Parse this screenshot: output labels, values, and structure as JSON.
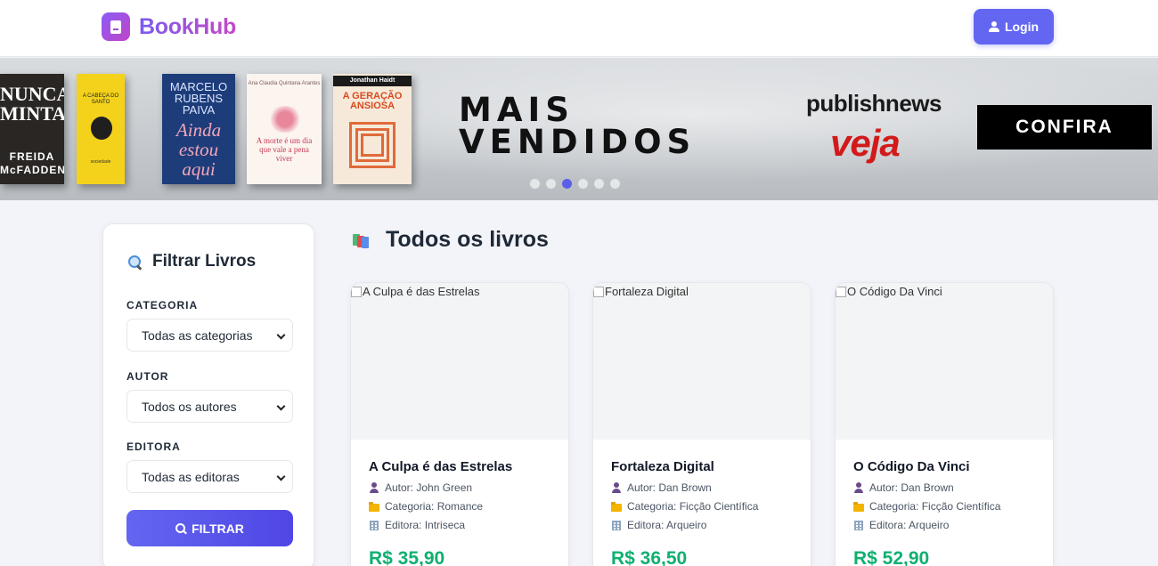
{
  "header": {
    "brand": "BookHub",
    "login_label": "Login"
  },
  "banner": {
    "books": [
      {
        "title": "NUNCA MINTA",
        "author": "FREIDA McFADDEN"
      },
      {
        "title": "A CABEÇA DO SANTO",
        "author": "sociedade"
      },
      {
        "title": "Ainda estou aqui",
        "author": "MARCELO RUBENS PAIVA"
      },
      {
        "title": "A morte é um dia que vale a pena viver",
        "author": "Ana Claudia Quintana Arantes"
      },
      {
        "title": "A GERAÇÃO ANSIOSA",
        "author": "Jonathan Haidt"
      }
    ],
    "headline_line1": "MAIS",
    "headline_line2": "VENDIDOS",
    "logo1": "publishnews",
    "logo2": "veja",
    "cta_label": "CONFIRA",
    "active_slide": 3,
    "slide_count": 6
  },
  "sidebar": {
    "title": "Filtrar Livros",
    "category_label": "CATEGORIA",
    "category_value": "Todas as categorias",
    "author_label": "AUTOR",
    "author_value": "Todos os autores",
    "publisher_label": "EDITORA",
    "publisher_value": "Todas as editoras",
    "filter_button": "FILTRAR"
  },
  "main": {
    "title": "Todos os livros",
    "books": [
      {
        "alt": "A Culpa é das Estrelas",
        "title": "A Culpa é das Estrelas",
        "author": "Autor: John Green",
        "category": "Categoria: Romance",
        "publisher": "Editora: Intriseca",
        "price": "R$ 35,90"
      },
      {
        "alt": "Fortaleza Digital",
        "title": "Fortaleza Digital",
        "author": "Autor: Dan Brown",
        "category": "Categoria: Ficção Científica",
        "publisher": "Editora: Arqueiro",
        "price": "R$ 36,50"
      },
      {
        "alt": "O Código Da Vinci",
        "title": "O Código Da Vinci",
        "author": "Autor: Dan Brown",
        "category": "Categoria: Ficção Científica",
        "publisher": "Editora: Arqueiro",
        "price": "R$ 52,90"
      }
    ]
  },
  "colors": {
    "accent": "#6366f1",
    "price": "#10b070",
    "brand_gradient_start": "#7c5bf0",
    "brand_gradient_end": "#c548c7"
  }
}
